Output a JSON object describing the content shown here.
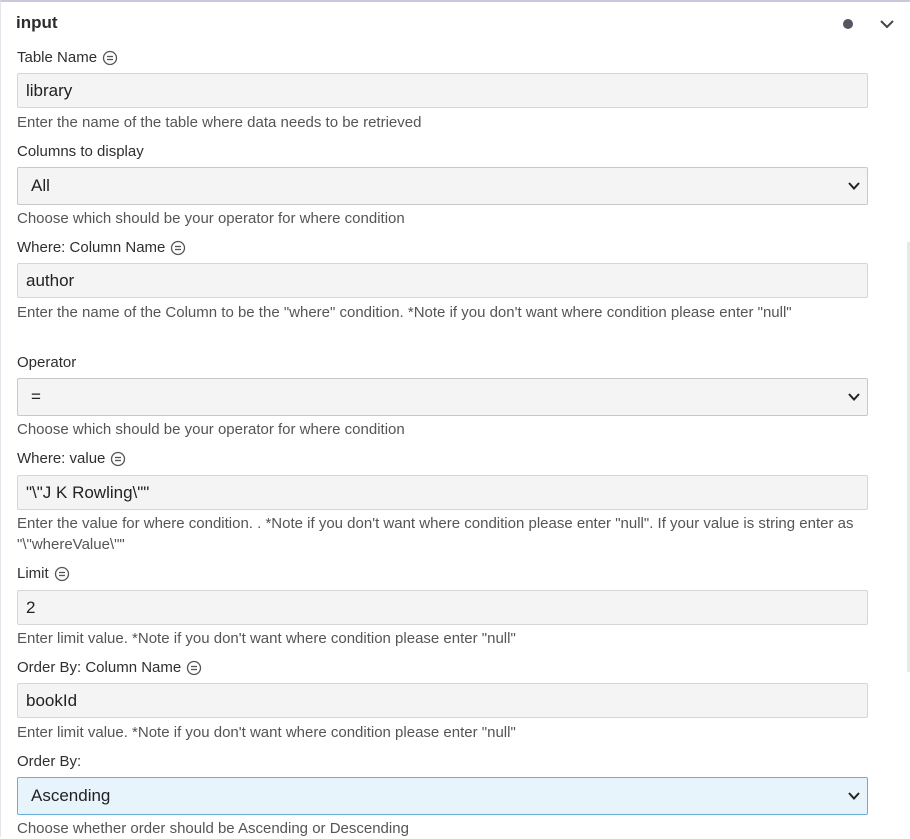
{
  "section": {
    "title": "input"
  },
  "fields": {
    "table_name": {
      "label": "Table Name",
      "value": "library",
      "help": "Enter the name of the table where data needs to be retrieved"
    },
    "columns": {
      "label": "Columns to display",
      "value": "All",
      "help": "Choose which should be your operator for where condition"
    },
    "where_column": {
      "label": "Where: Column Name",
      "value": "author",
      "help": "Enter the name of the Column to be the \"where\" condition. *Note if you don't want where condition please enter \"null\""
    },
    "operator": {
      "label": "Operator",
      "value": "=",
      "help": "Choose which should be your operator for where condition"
    },
    "where_value": {
      "label": "Where: value",
      "value": "\"\\\"J K Rowling\\\"\"",
      "help": "Enter the value for where condition. . *Note if you don't want where condition please enter \"null\". If your value is string enter as \"\\\"whereValue\\\"\""
    },
    "limit": {
      "label": "Limit",
      "value": "2",
      "help": "Enter limit value. *Note if you don't want where condition please enter \"null\""
    },
    "order_column": {
      "label": "Order By: Column Name",
      "value": "bookId",
      "help": "Enter limit value. *Note if you don't want where condition please enter \"null\""
    },
    "order_by": {
      "label": "Order By:",
      "value": "Ascending",
      "help": "Choose whether order should be Ascending or Descending"
    }
  },
  "icons": {
    "info": "info-circle-icon",
    "collapse": "chevron-down-icon",
    "status": "dot-icon",
    "dropdown": "chevron-down-icon"
  },
  "colors": {
    "field_bg": "#f4f4f4",
    "focused_select_bg": "#e8f4fc",
    "focused_select_border": "#6aaed6"
  }
}
